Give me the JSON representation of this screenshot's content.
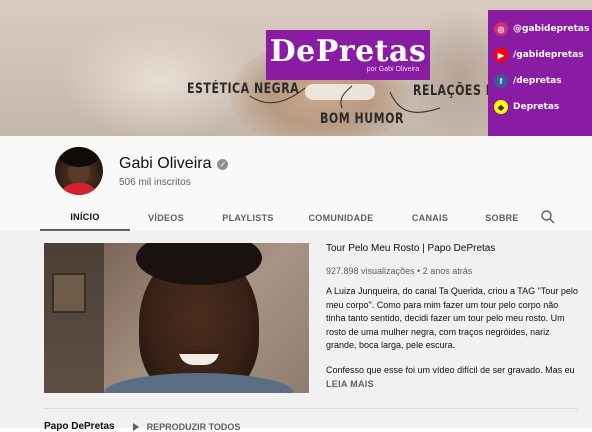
{
  "banner": {
    "logo": "DePretas",
    "logo_sub": "por Gabi Oliveira",
    "taglines": [
      "ESTÉTICA NEGRA",
      "BOM HUMOR",
      "RELAÇÕES RACIAIS"
    ],
    "social": [
      {
        "icon": "instagram-icon",
        "label": "@gabidepretas"
      },
      {
        "icon": "youtube-icon",
        "label": "/gabidepretas"
      },
      {
        "icon": "facebook-icon",
        "label": "/depretas"
      },
      {
        "icon": "snapchat-icon",
        "label": "Depretas"
      }
    ],
    "brand_color": "#8a1ca4"
  },
  "channel": {
    "name": "Gabi Oliveira",
    "subscribers": "506 mil inscritos"
  },
  "tabs": [
    {
      "label": "INÍCIO",
      "active": true
    },
    {
      "label": "VÍDEOS",
      "active": false
    },
    {
      "label": "PLAYLISTS",
      "active": false
    },
    {
      "label": "COMUNIDADE",
      "active": false
    },
    {
      "label": "CANAIS",
      "active": false
    },
    {
      "label": "SOBRE",
      "active": false
    }
  ],
  "featured": {
    "title": "Tour Pelo Meu Rosto | Papo DePretas",
    "meta": "927.898 visualizações • 2 anos atrás",
    "description": "A Luiza Junqueira, do canal Ta Querida, criou a TAG \"Tour pelo meu corpo\". Como para mim fazer um tour pelo corpo não tinha tanto sentido, decidi fazer um tour pelo meu rosto. Um rosto de uma mulher negra, com traços negróides, nariz grande, boca larga, pele escura.",
    "description2": "Confesso que esse foi um vídeo difícil de ser gravado. Mas eu",
    "more": "LEIA MAIS"
  },
  "section": {
    "title": "Papo DePretas",
    "play_all": "REPRODUZIR TODOS"
  }
}
